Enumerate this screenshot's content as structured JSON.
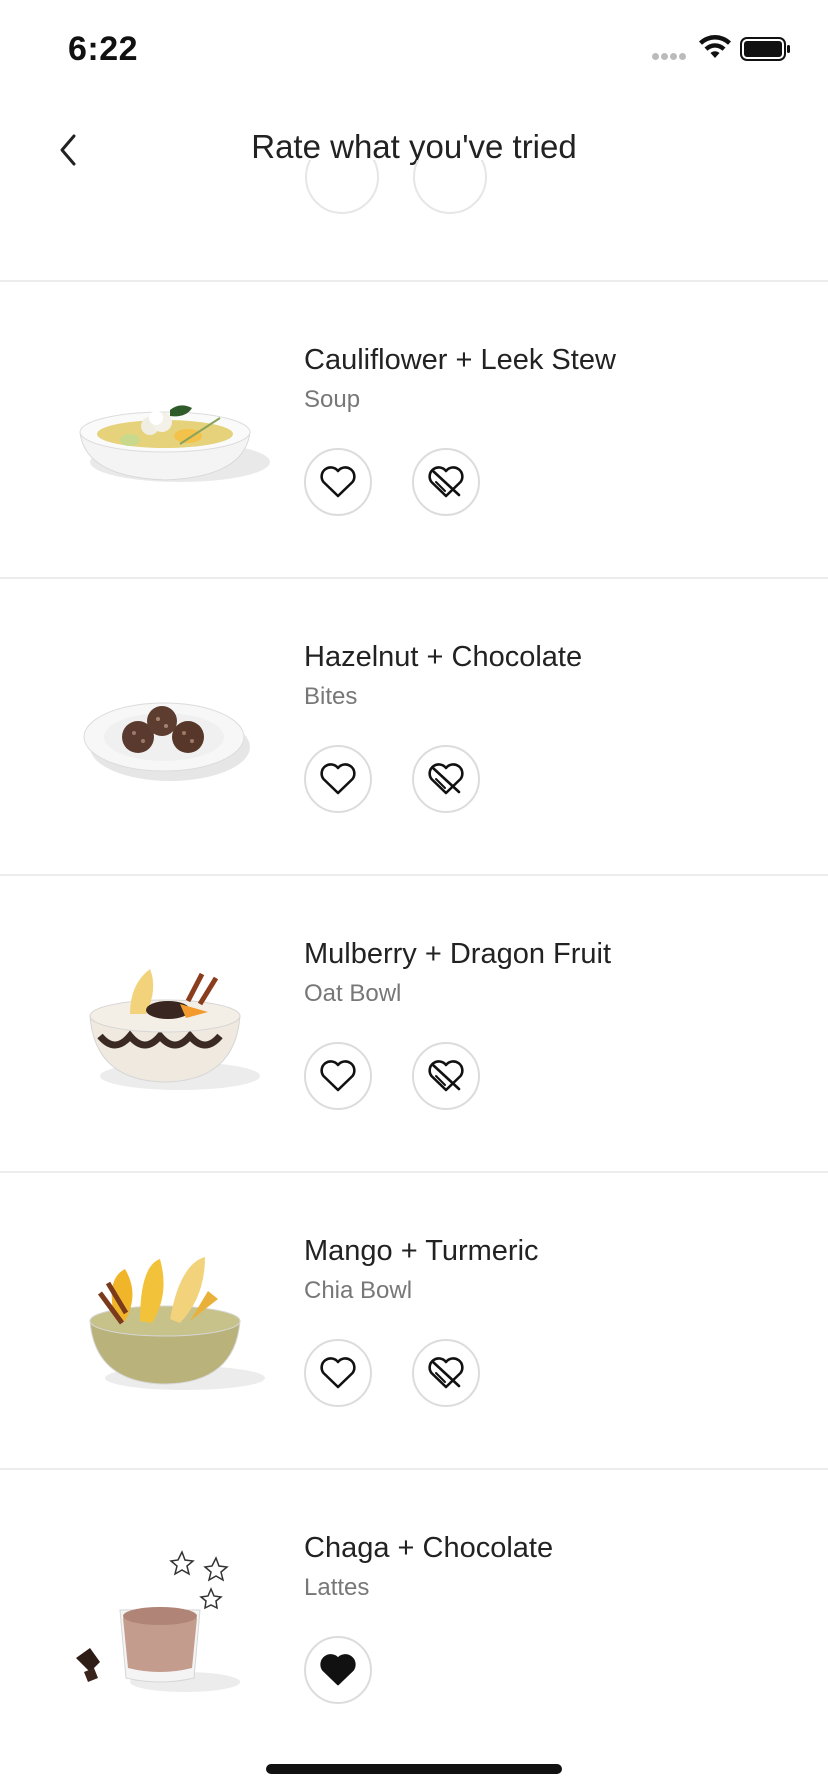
{
  "status_bar": {
    "time": "6:22"
  },
  "header": {
    "title": "Rate what you've tried"
  },
  "items": [
    {
      "name": "Cauliflower + Leek Stew",
      "category": "Soup",
      "liked": false
    },
    {
      "name": "Hazelnut + Chocolate",
      "category": "Bites",
      "liked": false
    },
    {
      "name": "Mulberry + Dragon Fruit",
      "category": "Oat Bowl",
      "liked": false
    },
    {
      "name": "Mango + Turmeric",
      "category": "Chia Bowl",
      "liked": false
    },
    {
      "name": "Chaga + Chocolate",
      "category": "Lattes",
      "liked": true
    }
  ],
  "icons": {
    "like": "heart-icon",
    "dislike": "broken-heart-icon",
    "back": "chevron-left-icon"
  }
}
